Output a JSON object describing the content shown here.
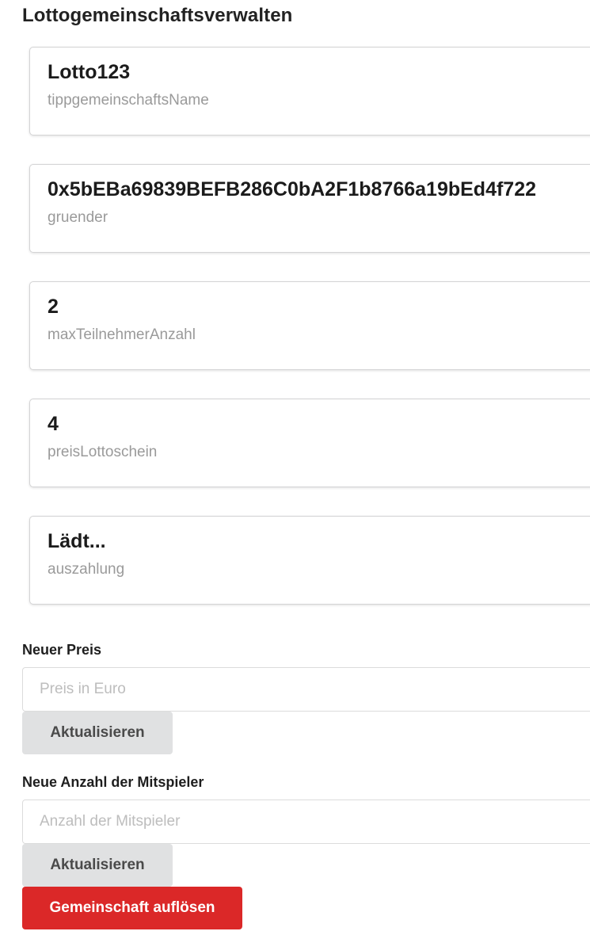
{
  "page": {
    "title": "Lottogemeinschaftsverwalten"
  },
  "cards": [
    {
      "value": "Lotto123",
      "label": "tippgemeinschaftsName"
    },
    {
      "value": "0x5bEBa69839BEFB286C0bA2F1b8766a19bEd4f722",
      "label": "gruender"
    },
    {
      "value": "2",
      "label": "maxTeilnehmerAnzahl"
    },
    {
      "value": "4",
      "label": "preisLottoschein"
    },
    {
      "value": "Lädt...",
      "label": "auszahlung"
    }
  ],
  "price_form": {
    "label": "Neuer Preis",
    "value": "",
    "placeholder": "Preis in Euro",
    "button": "Aktualisieren"
  },
  "players_form": {
    "label": "Neue Anzahl der Mitspieler",
    "value": "",
    "placeholder": "Anzahl der Mitspieler",
    "button": "Aktualisieren"
  },
  "dissolve_button": {
    "label": "Gemeinschaft auflösen",
    "color": "#db2828"
  }
}
